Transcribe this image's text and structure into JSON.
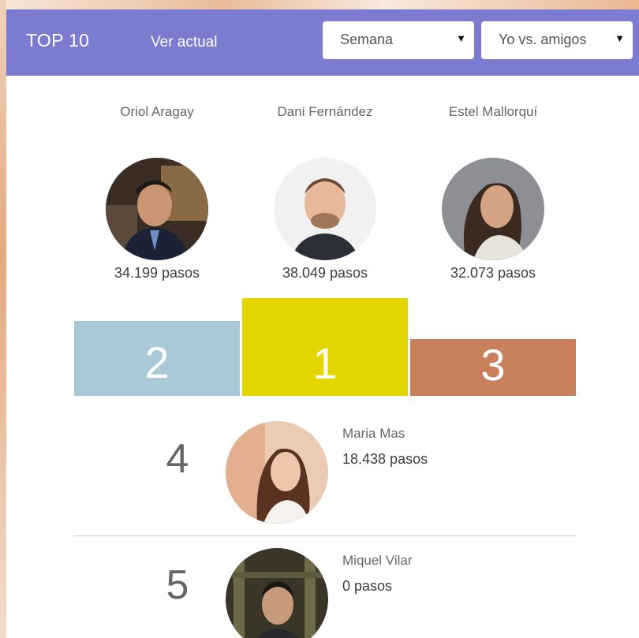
{
  "header": {
    "title": "TOP 10",
    "view_current": "Ver actual",
    "period_select": "Semana",
    "compare_select": "Yo vs. amigos"
  },
  "podium": [
    {
      "rank": "2",
      "name": "Oriol Aragay",
      "steps": "34.199 pasos",
      "block_color": "#a9c9d7"
    },
    {
      "rank": "1",
      "name": "Dani Fernández",
      "steps": "38.049 pasos",
      "block_color": "#e3d600"
    },
    {
      "rank": "3",
      "name": "Estel Mallorquí",
      "steps": "32.073 pasos",
      "block_color": "#c9815d"
    }
  ],
  "list": [
    {
      "rank": "4",
      "name": "Maria Mas",
      "steps": "18.438 pasos"
    },
    {
      "rank": "5",
      "name": "Miquel Vilar",
      "steps": "0 pasos"
    }
  ],
  "colors": {
    "header_bg": "#7b7ccf",
    "panel_bg": "#ffffff"
  }
}
